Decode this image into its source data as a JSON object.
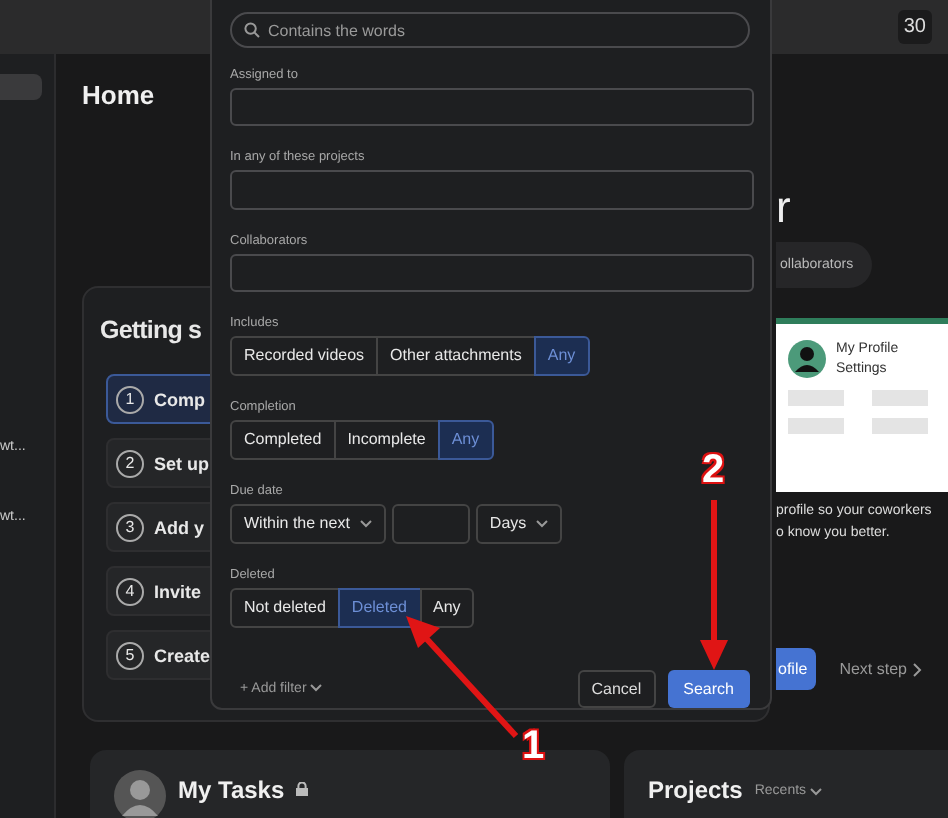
{
  "top_bar": {
    "badge": "30"
  },
  "sidebar": {
    "items": [
      "wt...",
      "wt..."
    ]
  },
  "home": {
    "title": "Home"
  },
  "getting_started": {
    "title": "Getting s",
    "steps": [
      {
        "number": "1",
        "label": "Comp",
        "selected": true
      },
      {
        "number": "2",
        "label": "Set up",
        "selected": false
      },
      {
        "number": "3",
        "label": "Add y",
        "selected": false
      },
      {
        "number": "4",
        "label": "Invite",
        "selected": false
      },
      {
        "number": "5",
        "label": "Create",
        "selected": false
      }
    ]
  },
  "right_panel": {
    "heading": "r",
    "pill": "ollaborators",
    "illustration_title": "My Profile Settings",
    "description": [
      "profile so your coworkers",
      "o know you better."
    ],
    "primary_button": "ofile",
    "next_button": "Next step"
  },
  "my_tasks": {
    "title": "My Tasks"
  },
  "projects": {
    "title": "Projects",
    "filter": "Recents"
  },
  "modal": {
    "search_placeholder": "Contains the words",
    "fields": [
      {
        "label": "Assigned to"
      },
      {
        "label": "In any of these projects"
      },
      {
        "label": "Collaborators"
      }
    ],
    "segments": [
      {
        "label": "Includes",
        "options": [
          {
            "label": "Recorded videos",
            "selected": false
          },
          {
            "label": "Other attachments",
            "selected": false
          },
          {
            "label": "Any",
            "selected": true
          }
        ]
      },
      {
        "label": "Completion",
        "options": [
          {
            "label": "Completed",
            "selected": false
          },
          {
            "label": "Incomplete",
            "selected": false
          },
          {
            "label": "Any",
            "selected": true
          }
        ]
      }
    ],
    "due_date": {
      "label": "Due date",
      "range": "Within the next",
      "unit": "Days"
    },
    "deleted": {
      "label": "Deleted",
      "options": [
        {
          "label": "Not deleted",
          "selected": false
        },
        {
          "label": "Deleted",
          "selected": true
        },
        {
          "label": "Any",
          "selected": false
        }
      ]
    },
    "add_filter": "+ Add filter",
    "cancel": "Cancel",
    "search": "Search"
  },
  "annotations": [
    "1",
    "2"
  ]
}
